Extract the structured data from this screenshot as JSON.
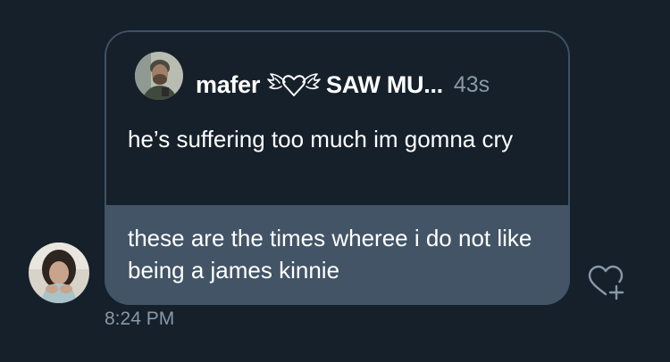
{
  "quoted_message": {
    "author_name": "mafer",
    "author_suffix": "SAW MU...",
    "author_decoration_icon": "winged-heart-icon",
    "time_ago": "43s",
    "text": "he’s suffering too much im gomna cry"
  },
  "message": {
    "text": "these are the times wheree i do not like being a james kinnie",
    "timestamp": "8:24 PM",
    "react_icon": "heart-plus-icon"
  },
  "colors": {
    "background": "#15202b",
    "bubble": "#425466",
    "border": "#3e5263",
    "secondary_text": "#8899a6"
  }
}
